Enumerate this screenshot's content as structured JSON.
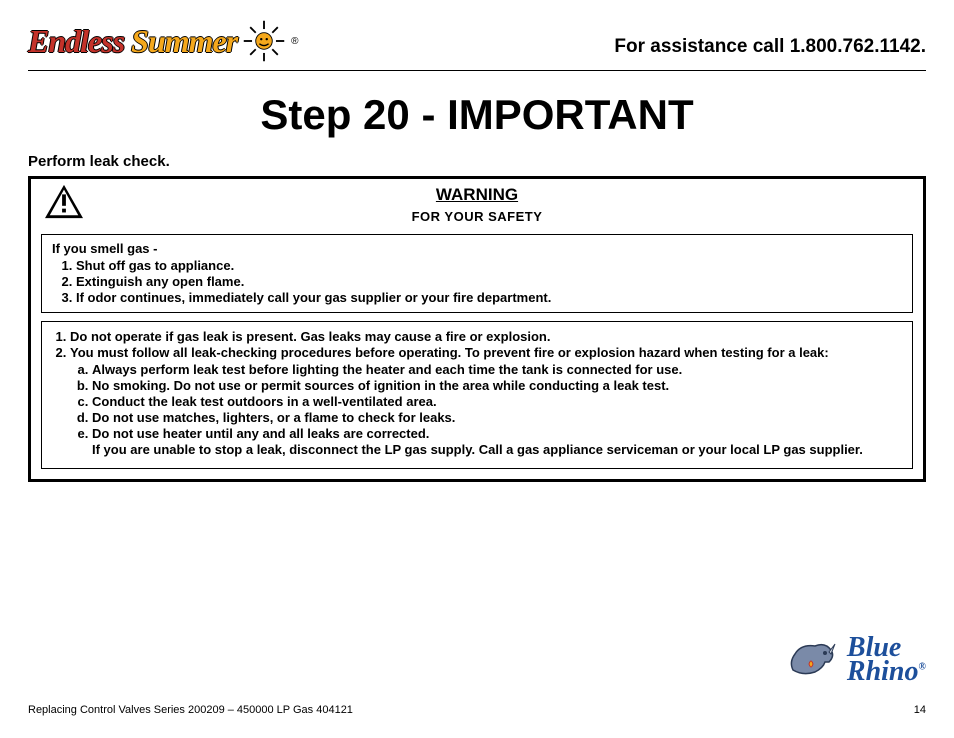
{
  "header": {
    "brand_word1": "Endless",
    "brand_word2": "Summer",
    "assistance": "For assistance call 1.800.762.1142."
  },
  "title": "Step 20 - IMPORTANT",
  "subtitle": "Perform leak check.",
  "warning": {
    "heading": "WARNING",
    "subheading": "FOR YOUR SAFETY",
    "smell_intro": "If you smell gas -",
    "smell_steps": [
      "Shut off gas to appliance.",
      "Extinguish any open flame.",
      "If odor continues, immediately call your gas supplier or your fire department."
    ],
    "main_items": [
      "Do not operate if gas leak is present. Gas leaks may cause a fire or explosion.",
      "You must follow all leak-checking procedures before operating. To prevent fire or explosion hazard when testing for a leak:"
    ],
    "sub_items": [
      "Always perform leak test before lighting the heater and each time the tank is connected for use.",
      "No smoking.  Do not use or permit sources of ignition in the area while conducting a leak test.",
      "Conduct the leak test outdoors in a well-ventilated area.",
      "Do not use matches, lighters, or a flame to check for leaks.",
      "Do not use heater until any and all leaks are corrected."
    ],
    "sub_note": "If you are unable to stop a leak, disconnect the LP gas supply.  Call a gas appliance serviceman or your local LP gas supplier."
  },
  "footer": {
    "left": "Replacing Control Valves   Series 200209 – 450000 LP Gas    404121",
    "page": "14",
    "brand2_line1": "Blue",
    "brand2_line2": "Rhino"
  }
}
